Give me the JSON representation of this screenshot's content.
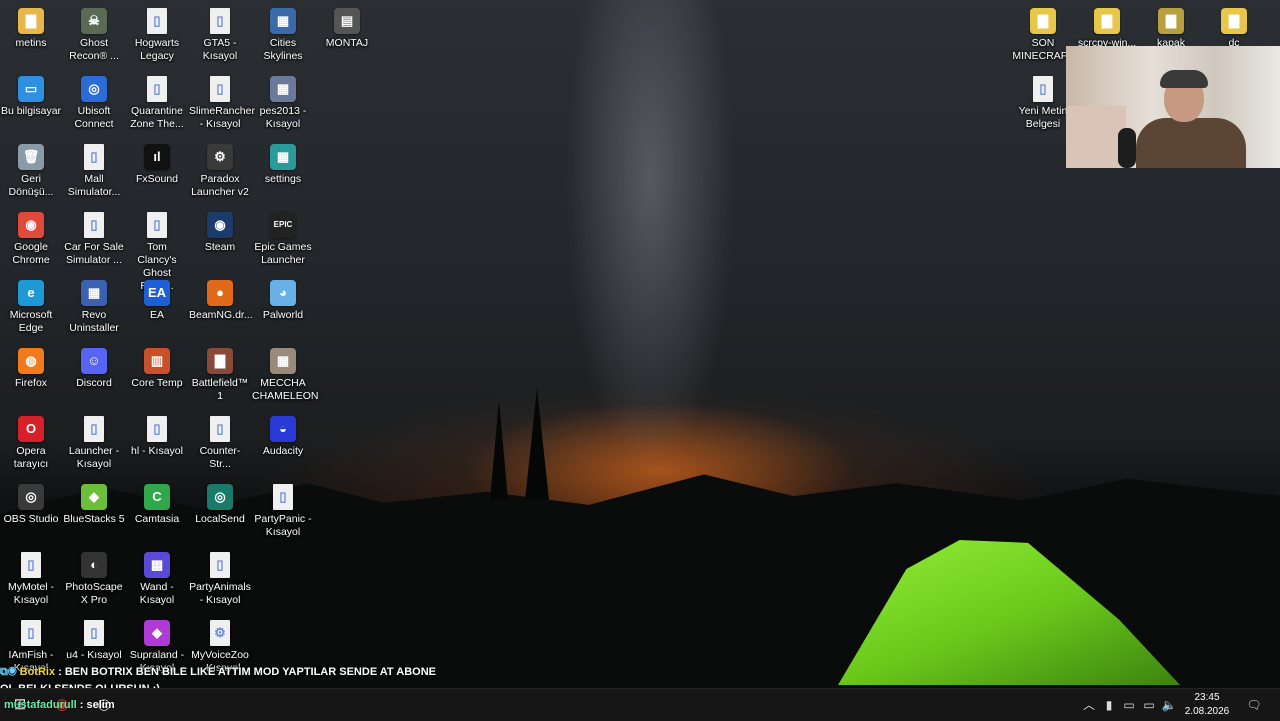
{
  "desktop_icons": [
    {
      "label": "metins",
      "color": "#e8b64a",
      "glyph": "▇"
    },
    {
      "label": "Bu bilgisayar",
      "color": "#2f8fe0",
      "glyph": "▭"
    },
    {
      "label": "Geri Dönüşü...",
      "color": "#8a9aa8",
      "glyph": "🗑"
    },
    {
      "label": "Google Chrome",
      "color": "#e04a3a",
      "glyph": "◉"
    },
    {
      "label": "Microsoft Edge",
      "color": "#1d9ad6",
      "glyph": "e"
    },
    {
      "label": "Firefox",
      "color": "#f07a1c",
      "glyph": "◍"
    },
    {
      "label": "Opera tarayıcı",
      "color": "#d6202a",
      "glyph": "O"
    },
    {
      "label": "OBS Studio",
      "color": "#3a3a3a",
      "glyph": "◎"
    },
    {
      "label": "MyMotel - Kısayol",
      "color": "#f0f0f0",
      "glyph": "▯"
    },
    {
      "label": "IAmFish - Kısayol",
      "color": "#f0f0f0",
      "glyph": "▯"
    },
    {
      "label": "Ghost Recon® ...",
      "color": "#5a6a55",
      "glyph": "☠"
    },
    {
      "label": "Ubisoft Connect",
      "color": "#2d6bd6",
      "glyph": "◎"
    },
    {
      "label": "Mall Simulator...",
      "color": "#f0f0f0",
      "glyph": "▯"
    },
    {
      "label": "Car For Sale Simulator ...",
      "color": "#f0f0f0",
      "glyph": "▯"
    },
    {
      "label": "Revo Uninstaller",
      "color": "#3b62b0",
      "glyph": "▦"
    },
    {
      "label": "Discord",
      "color": "#5865f2",
      "glyph": "☺"
    },
    {
      "label": "Launcher - Kısayol",
      "color": "#f0f0f0",
      "glyph": "▯"
    },
    {
      "label": "BlueStacks 5",
      "color": "#6cbf3a",
      "glyph": "◆"
    },
    {
      "label": "PhotoScape X Pro",
      "color": "#333333",
      "glyph": "◐"
    },
    {
      "label": "u4 - Kısayol",
      "color": "#f0f0f0",
      "glyph": "▯"
    },
    {
      "label": "Hogwarts Legacy",
      "color": "#f0f0f0",
      "glyph": "▯"
    },
    {
      "label": "Quarantine Zone The...",
      "color": "#f0f0f0",
      "glyph": "▯"
    },
    {
      "label": "FxSound",
      "color": "#111111",
      "glyph": "ıl"
    },
    {
      "label": "Tom Clancy's Ghost Reco...",
      "color": "#f0f0f0",
      "glyph": "▯"
    },
    {
      "label": "EA",
      "color": "#1f5fd6",
      "glyph": "EA"
    },
    {
      "label": "Core Temp",
      "color": "#c8502a",
      "glyph": "▥"
    },
    {
      "label": "hl - Kısayol",
      "color": "#f0f0f0",
      "glyph": "▯"
    },
    {
      "label": "Camtasia",
      "color": "#2ea84a",
      "glyph": "C"
    },
    {
      "label": "Wand - Kısayol",
      "color": "#5a4ad6",
      "glyph": "▩"
    },
    {
      "label": "Supraland - Kısayol",
      "color": "#b03ad6",
      "glyph": "◆"
    },
    {
      "label": "GTA5 - Kısayol",
      "color": "#f0f0f0",
      "glyph": "▯"
    },
    {
      "label": "SlimeRancher - Kısayol",
      "color": "#f0f0f0",
      "glyph": "▯"
    },
    {
      "label": "Paradox Launcher v2",
      "color": "#3a3a3a",
      "glyph": "⚙"
    },
    {
      "label": "Steam",
      "color": "#1b3c6a",
      "glyph": "◉"
    },
    {
      "label": "BeamNG.dr...",
      "color": "#e06a1c",
      "glyph": "●"
    },
    {
      "label": "Battlefield™ 1",
      "color": "#8a4a3a",
      "glyph": "▇"
    },
    {
      "label": "Counter-Str...",
      "color": "#f0f0f0",
      "glyph": "▯"
    },
    {
      "label": "LocalSend",
      "color": "#1a7a6a",
      "glyph": "◎"
    },
    {
      "label": "PartyAnimals - Kısayol",
      "color": "#f0f0f0",
      "glyph": "▯"
    },
    {
      "label": "MyVoiceZoo - Kısayol",
      "color": "#f0f0f0",
      "glyph": "⚙"
    },
    {
      "label": "Cities Skylines",
      "color": "#3a6aa8",
      "glyph": "▦"
    },
    {
      "label": "pes2013 - Kısayol",
      "color": "#6a7a9a",
      "glyph": "▦"
    },
    {
      "label": "settings",
      "color": "#2a9a9a",
      "glyph": "▦"
    },
    {
      "label": "Epic Games Launcher",
      "color": "#222222",
      "glyph": "EPIC"
    },
    {
      "label": "Palworld",
      "color": "#6ab0e8",
      "glyph": "◕"
    },
    {
      "label": "MECCHA CHAMELEON",
      "color": "#9a8a7a",
      "glyph": "▦"
    },
    {
      "label": "Audacity",
      "color": "#2a3ad6",
      "glyph": "◒"
    },
    {
      "label": "PartyPanic - Kısayol",
      "color": "#f0f0f0",
      "glyph": "▯"
    },
    {
      "label": "MONTAJ",
      "color": "#555555",
      "glyph": "▤"
    },
    {
      "label": "SON MINECRAFT",
      "color": "#e8c64a",
      "glyph": "▇"
    },
    {
      "label": "Yeni Metin Belgesi",
      "color": "#f0f0f0",
      "glyph": "▯"
    },
    {
      "label": "scrcpy-win...",
      "color": "#e8c64a",
      "glyph": "▇"
    },
    {
      "label": "kapak",
      "color": "#b8a040",
      "glyph": "▇"
    },
    {
      "label": "dc",
      "color": "#e8c64a",
      "glyph": "▇"
    }
  ],
  "chat": {
    "line1_user": "BotRix",
    "line1_text": " : BEN BOTRIX BEN BILE LIKE ATTIM MOD YAPTILAR SENDE AT ABONE",
    "line2_text": "OL BELKI SENDE OLURSUN :)",
    "line3_user": "mustafadurull",
    "line3_text": " : selim"
  },
  "taskbar": {
    "start_icon": "windows-logo-icon",
    "pinned": [
      "chrome-icon",
      "obs-icon"
    ],
    "tray": [
      "chevron-up-icon",
      "microphone-icon",
      "usb-icon",
      "battery-icon",
      "network-icon",
      "volume-icon"
    ],
    "time": "23:45",
    "date": "2.08.2026"
  }
}
